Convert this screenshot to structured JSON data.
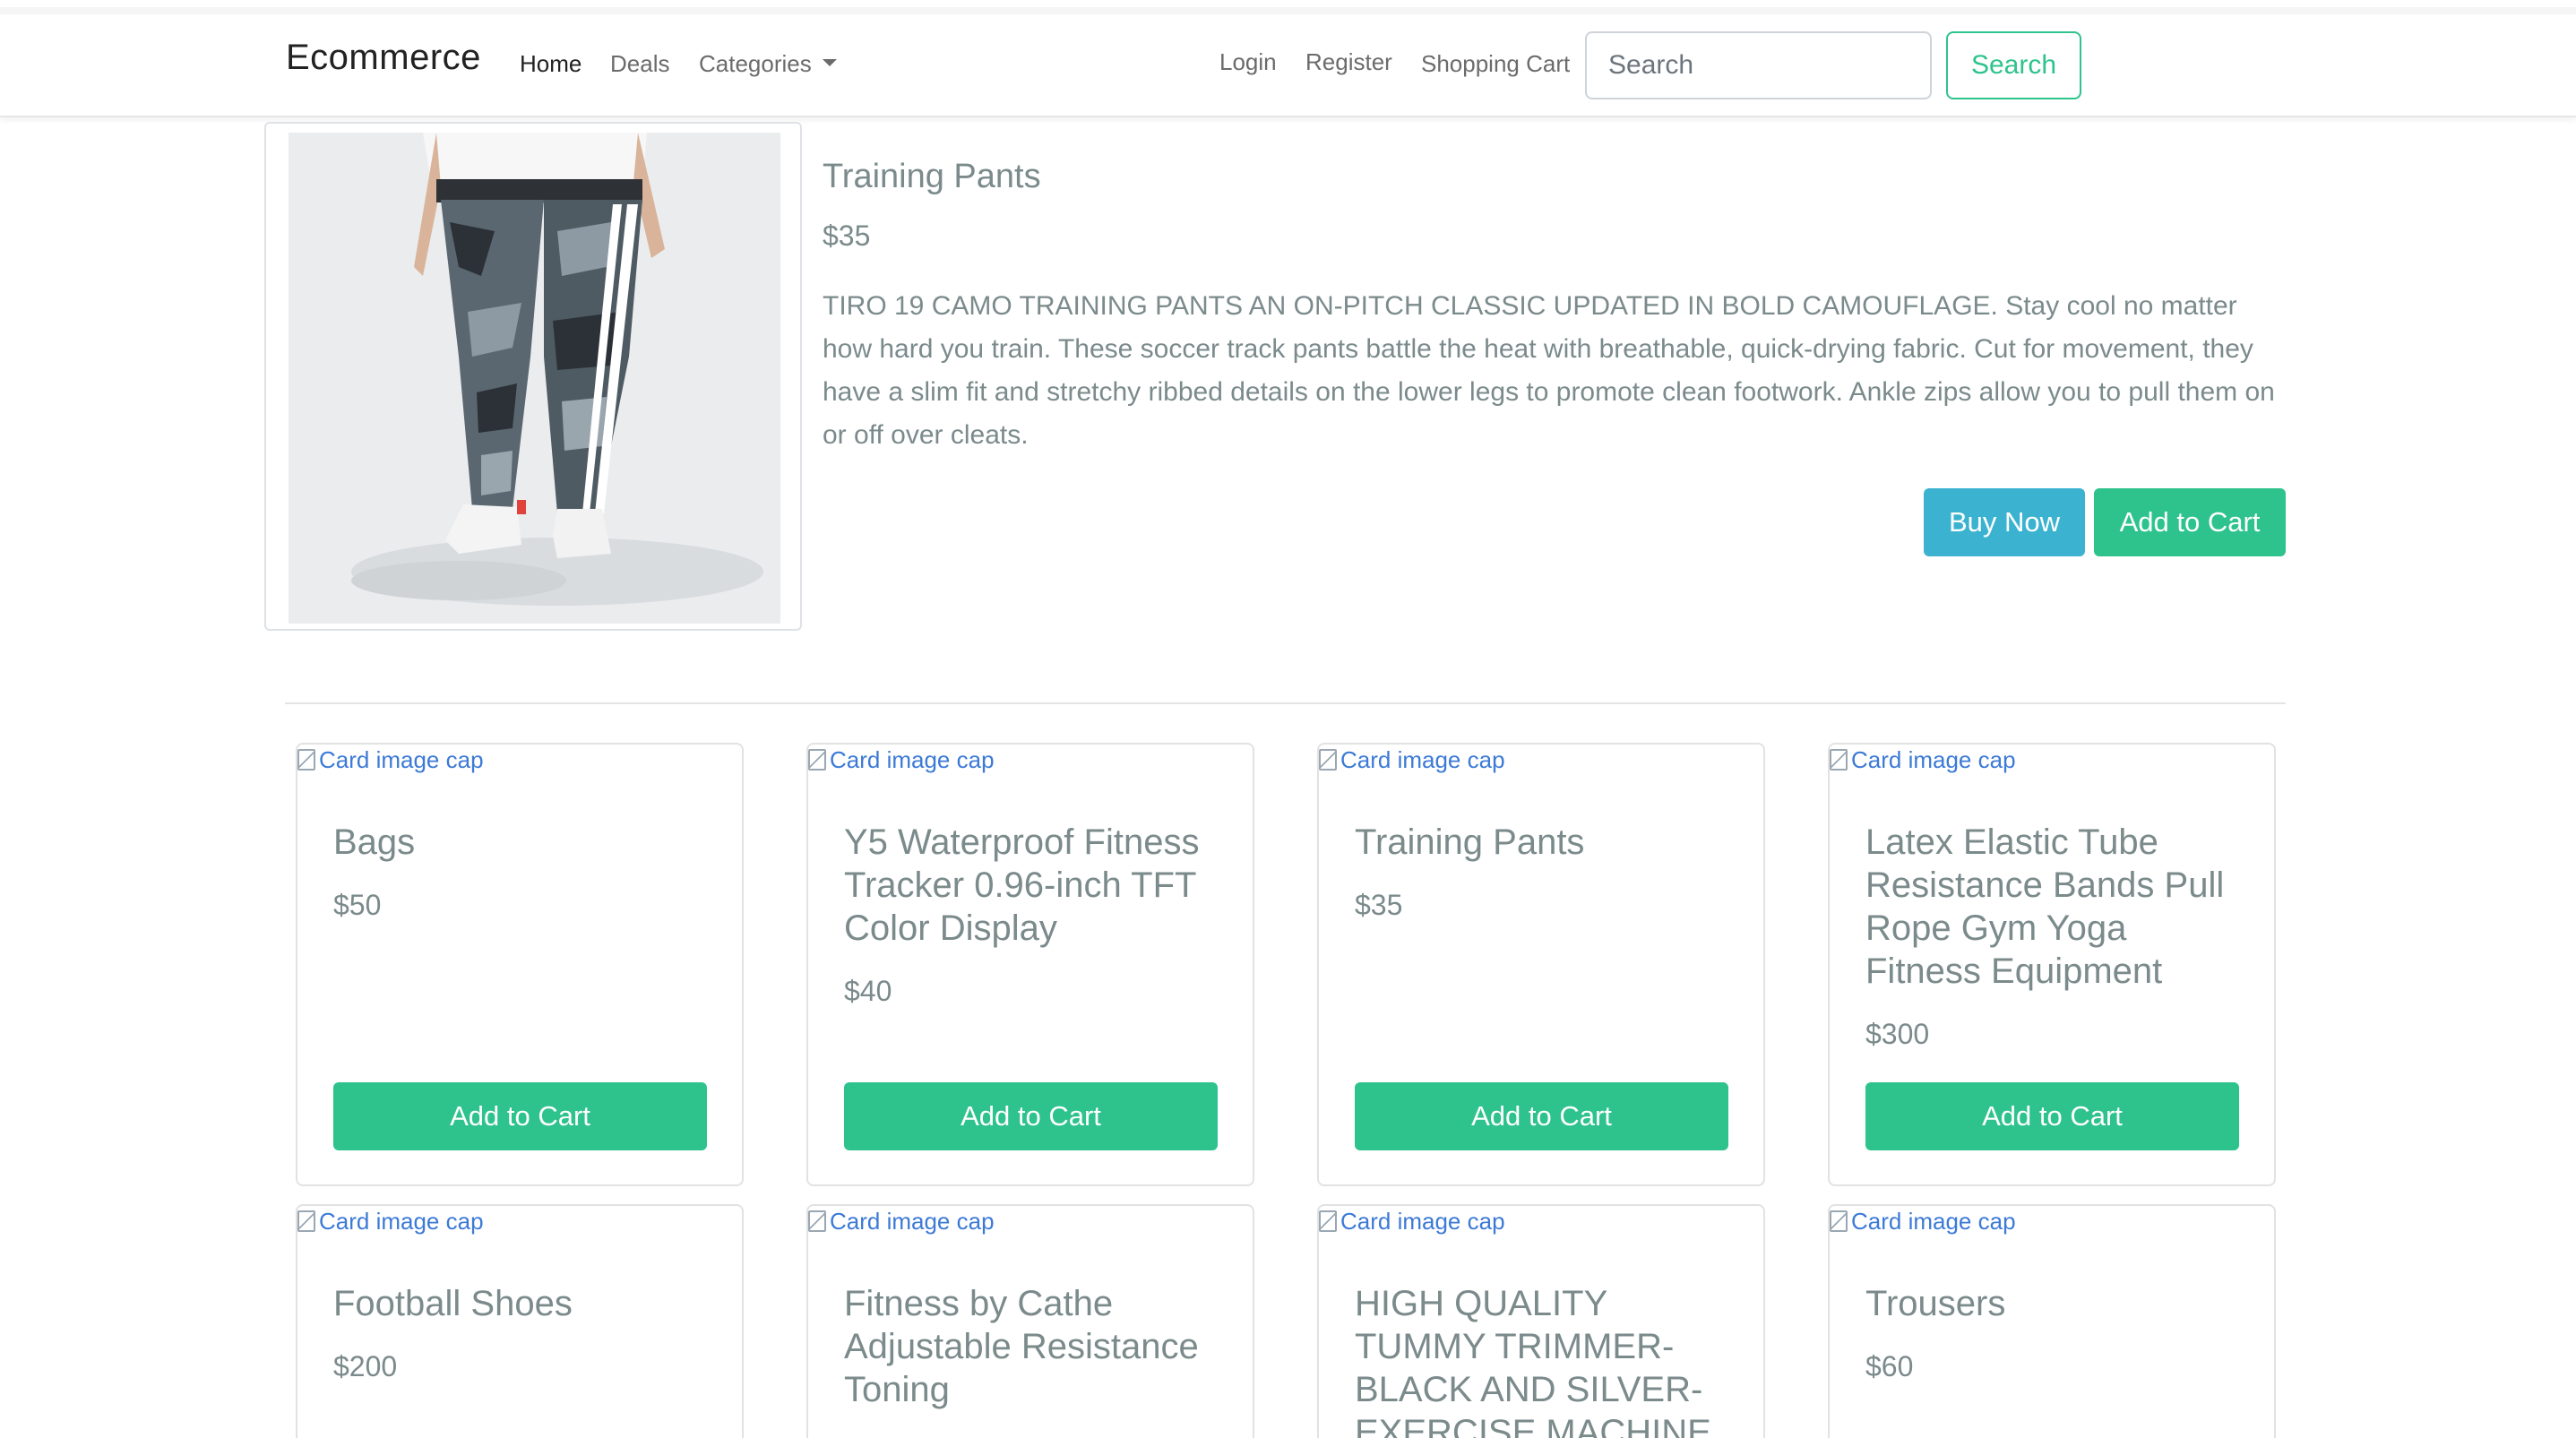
{
  "navbar": {
    "brand": "Ecommerce",
    "links": {
      "home": "Home",
      "deals": "Deals",
      "categories": "Categories",
      "login": "Login",
      "register": "Register",
      "cart": "Shopping Cart"
    },
    "search": {
      "placeholder": "Search",
      "button": "Search"
    }
  },
  "featured": {
    "title": "Training Pants",
    "price": "$35",
    "description": "TIRO 19 CAMO TRAINING PANTS AN ON-PITCH CLASSIC UPDATED IN BOLD CAMOUFLAGE. Stay cool no matter how hard you train. These soccer track pants battle the heat with breathable, quick-drying fabric. Cut for movement, they have a slim fit and stretchy ribbed details on the lower legs to promote clean footwork. Ankle zips allow you to pull them on or off over cleats.",
    "buy_now": "Buy Now",
    "add_to_cart": "Add to Cart"
  },
  "products": [
    {
      "img_alt": "Card image cap",
      "title": "Bags",
      "price": "$50",
      "button": "Add to Cart"
    },
    {
      "img_alt": "Card image cap",
      "title": "Y5 Waterproof Fitness Tracker 0.96-inch TFT Color Display",
      "price": "$40",
      "button": "Add to Cart"
    },
    {
      "img_alt": "Card image cap",
      "title": "Training Pants",
      "price": "$35",
      "button": "Add to Cart"
    },
    {
      "img_alt": "Card image cap",
      "title": "Latex Elastic Tube Resistance Bands Pull Rope Gym Yoga Fitness Equipment",
      "price": "$300",
      "button": "Add to Cart"
    },
    {
      "img_alt": "Card image cap",
      "title": "Football Shoes",
      "price": "$200"
    },
    {
      "img_alt": "Card image cap",
      "title": "Fitness by Cathe Adjustable Resistance Toning"
    },
    {
      "img_alt": "Card image cap",
      "title": "HIGH QUALITY TUMMY TRIMMER-BLACK AND SILVER-EXERCISE MACHINE"
    },
    {
      "img_alt": "Card image cap",
      "title": "Trousers",
      "price": "$60"
    }
  ],
  "colors": {
    "accent_green": "#2ec38c",
    "info_blue": "#3bb3d0",
    "muted_text": "#7b8a8b"
  }
}
